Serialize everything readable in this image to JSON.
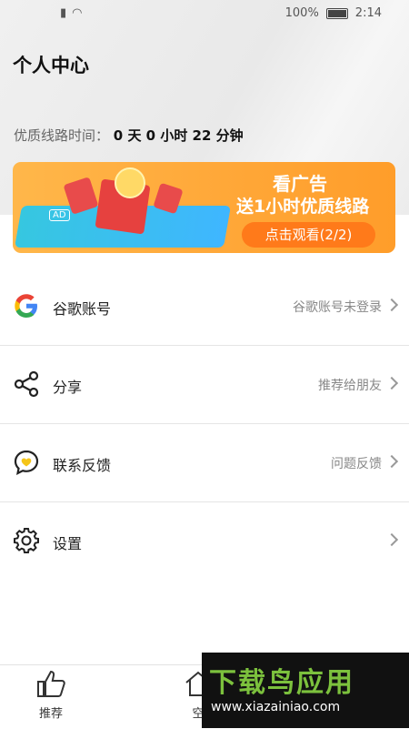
{
  "status_bar": {
    "battery": "100%",
    "time": "2:14"
  },
  "page": {
    "title": "个人中心"
  },
  "line_time": {
    "label": "优质线路时间：",
    "value": "0 天 0 小时 22 分钟"
  },
  "banner": {
    "title": "看广告",
    "subtitle": "送1小时优质线路",
    "button": "点击观看(2/2)",
    "ad_tag": "AD"
  },
  "menu": [
    {
      "label": "谷歌账号",
      "hint": "谷歌账号未登录",
      "icon": "google-icon"
    },
    {
      "label": "分享",
      "hint": "推荐给朋友",
      "icon": "share-icon"
    },
    {
      "label": "联系反馈",
      "hint": "问题反馈",
      "icon": "feedback-icon"
    },
    {
      "label": "设置",
      "hint": "",
      "icon": "gear-icon"
    }
  ],
  "tabs": [
    {
      "label": "推荐",
      "icon": "thumbs-up-icon"
    },
    {
      "label": "空",
      "icon": "home-icon"
    }
  ],
  "watermark": {
    "title": "下载鸟应用",
    "url": "www.xiazainiao.com"
  }
}
